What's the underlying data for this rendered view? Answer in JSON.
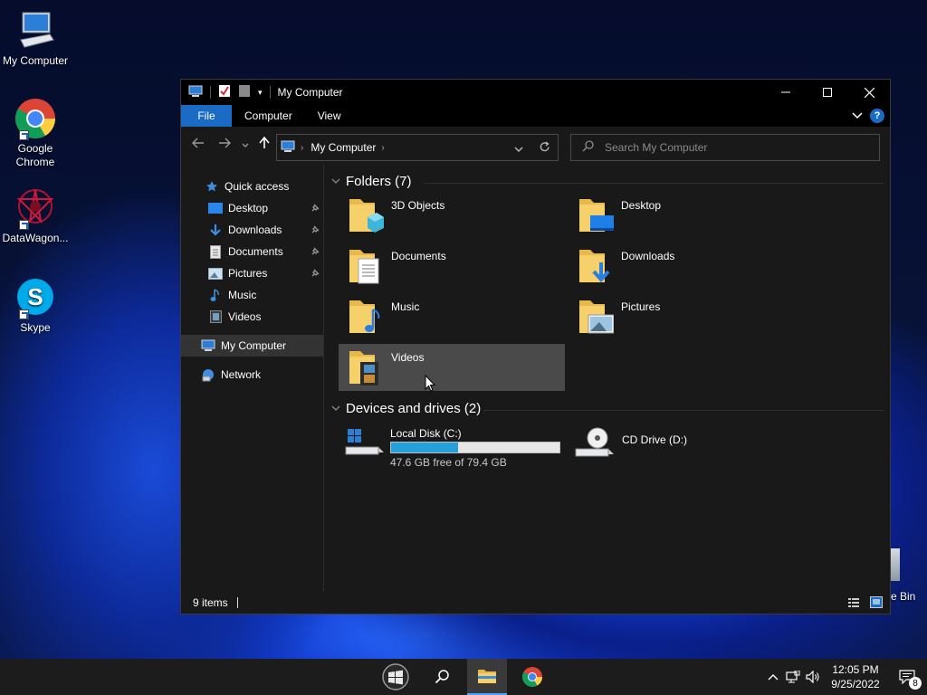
{
  "desktop": {
    "icons": [
      {
        "label": "My Computer",
        "icon": "computer-icon"
      },
      {
        "label": "Google Chrome",
        "icon": "chrome-icon"
      },
      {
        "label": "DataWagon...",
        "icon": "datawagon-icon"
      },
      {
        "label": "Skype",
        "icon": "skype-icon"
      }
    ],
    "recycle_bin_partial_label": "e Bin"
  },
  "window": {
    "title": "My Computer",
    "ribbon": {
      "tabs": [
        "File",
        "Computer",
        "View"
      ]
    },
    "address": {
      "segment": "My Computer"
    },
    "search": {
      "placeholder": "Search My Computer"
    },
    "nav": {
      "quick_access": "Quick access",
      "pinned": [
        {
          "label": "Desktop",
          "pinned": true
        },
        {
          "label": "Downloads",
          "pinned": true
        },
        {
          "label": "Documents",
          "pinned": true
        },
        {
          "label": "Pictures",
          "pinned": true
        },
        {
          "label": "Music",
          "pinned": false
        },
        {
          "label": "Videos",
          "pinned": false
        }
      ],
      "my_computer": "My Computer",
      "network": "Network"
    },
    "folders_header": "Folders (7)",
    "folders": [
      {
        "label": "3D Objects",
        "icon": "3d-objects-folder-icon"
      },
      {
        "label": "Desktop",
        "icon": "desktop-folder-icon"
      },
      {
        "label": "Documents",
        "icon": "documents-folder-icon"
      },
      {
        "label": "Downloads",
        "icon": "downloads-folder-icon"
      },
      {
        "label": "Music",
        "icon": "music-folder-icon"
      },
      {
        "label": "Pictures",
        "icon": "pictures-folder-icon"
      },
      {
        "label": "Videos",
        "icon": "videos-folder-icon"
      }
    ],
    "drives_header": "Devices and drives (2)",
    "drives": [
      {
        "label": "Local Disk (C:)",
        "free_text": "47.6 GB free of 79.4 GB",
        "used_fraction": 0.4
      },
      {
        "label": "CD Drive (D:)"
      }
    ],
    "status": {
      "items": "9 items"
    }
  },
  "taskbar": {
    "time": "12:05 PM",
    "date": "9/25/2022",
    "notification_count": "8"
  },
  "colors": {
    "accent": "#1a6bc4",
    "drive_bar": "#26a0da",
    "window_bg": "#191919",
    "titlebar_bg": "#000000",
    "taskbar_bg": "#1c1c1c"
  }
}
